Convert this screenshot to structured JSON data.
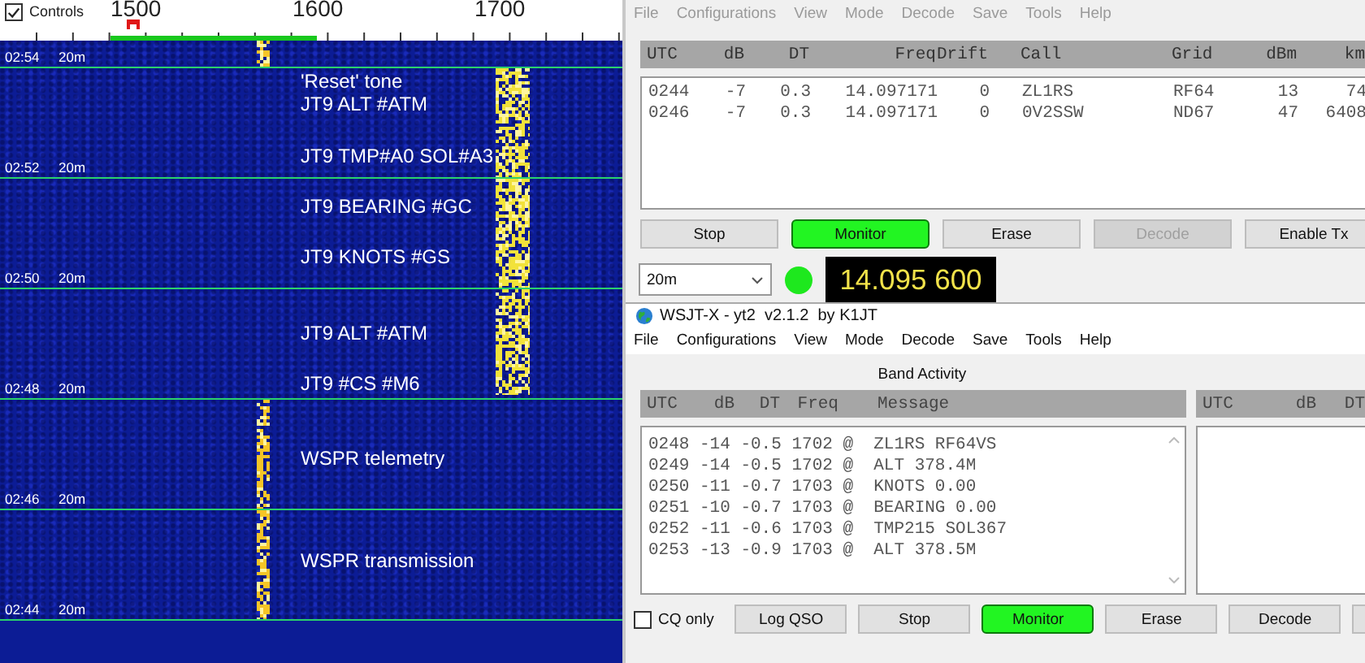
{
  "waterfall": {
    "controls": {
      "label": "Controls",
      "checked": true
    },
    "scale_labels": [
      "1500",
      "1600",
      "1700"
    ],
    "rows": [
      {
        "time": "02:54",
        "band": "20m",
        "kind": "wspr",
        "annotations": []
      },
      {
        "time": "02:52",
        "band": "20m",
        "kind": "jt9",
        "annotations": [
          "'Reset' tone",
          "JT9 ALT #ATM",
          "JT9 TMP#A0 SOL#A3"
        ]
      },
      {
        "time": "02:50",
        "band": "20m",
        "kind": "jt9",
        "annotations": [
          "JT9 BEARING #GC",
          "JT9 KNOTS #GS"
        ]
      },
      {
        "time": "02:48",
        "band": "20m",
        "kind": "jt9",
        "annotations": [
          "JT9 ALT #ATM",
          "JT9 #CS #M6"
        ]
      },
      {
        "time": "02:46",
        "band": "20m",
        "kind": "wspr",
        "annotations": [
          "WSPR telemetry"
        ]
      },
      {
        "time": "02:44",
        "band": "20m",
        "kind": "wspr",
        "annotations": [
          "WSPR transmission"
        ]
      }
    ]
  },
  "wspr_window": {
    "menu": [
      "File",
      "Configurations",
      "View",
      "Mode",
      "Decode",
      "Save",
      "Tools",
      "Help"
    ],
    "columns": [
      "UTC",
      "dB",
      "DT",
      "Freq",
      "Drift",
      "Call",
      "Grid",
      "dBm",
      "km"
    ],
    "rows": [
      [
        "0244",
        "-7",
        "0.3",
        "14.097171",
        "0",
        "ZL1RS",
        "RF64",
        "13",
        "74"
      ],
      [
        "0246",
        "-7",
        "0.3",
        "14.097171",
        "0",
        "0V2SSW",
        "ND67",
        "47",
        "6408"
      ]
    ],
    "buttons": [
      {
        "label": "Stop",
        "on": false,
        "disabled": false
      },
      {
        "label": "Monitor",
        "on": true,
        "disabled": false
      },
      {
        "label": "Erase",
        "on": false,
        "disabled": false
      },
      {
        "label": "Decode",
        "on": false,
        "disabled": true
      },
      {
        "label": "Enable Tx",
        "on": false,
        "disabled": false
      }
    ],
    "band": "20m",
    "frequency": "14.095 600"
  },
  "jt_window": {
    "title": "WSJT-X - yt2  v2.1.2  by K1JT",
    "menu": [
      "File",
      "Configurations",
      "View",
      "Mode",
      "Decode",
      "Save",
      "Tools",
      "Help"
    ],
    "band_activity": "Band Activity",
    "columns": [
      "UTC",
      "dB",
      "DT",
      "Freq",
      "Message"
    ],
    "lines": [
      "0248 -14 -0.5 1702 @  ZL1RS RF64VS",
      "0249 -14 -0.5 1702 @  ALT 378.4M",
      "0250 -11 -0.7 1703 @  KNOTS 0.00",
      "0251 -10 -0.7 1703 @  BEARING 0.00",
      "0252 -11 -0.6 1703 @  TMP215 SOL367",
      "0253 -13 -0.9 1703 @  ALT 378.5M"
    ],
    "rx_columns": [
      "UTC",
      "dB",
      "DT"
    ],
    "cq_only": {
      "label": "CQ only",
      "checked": false
    },
    "buttons": [
      {
        "label": "Log QSO",
        "on": false
      },
      {
        "label": "Stop",
        "on": false
      },
      {
        "label": "Monitor",
        "on": true
      },
      {
        "label": "Erase",
        "on": false
      },
      {
        "label": "Decode",
        "on": false
      }
    ]
  }
}
